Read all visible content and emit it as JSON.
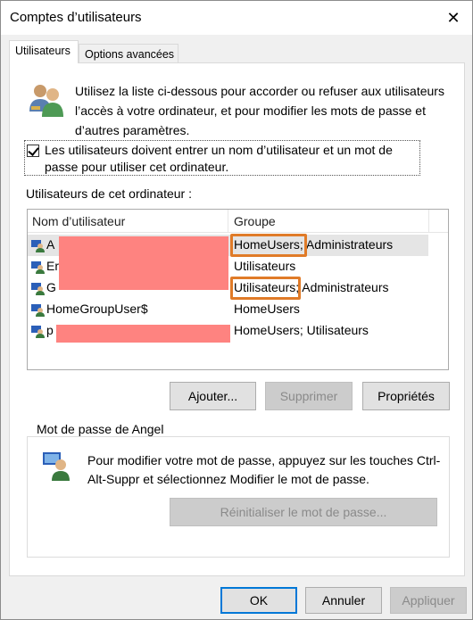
{
  "window": {
    "title": "Comptes d’utilisateurs",
    "close_glyph": "✕"
  },
  "tabs": [
    {
      "label": "Utilisateurs",
      "active": true
    },
    {
      "label": "Options avancées",
      "active": false
    }
  ],
  "intro": {
    "text": "Utilisez la liste ci-dessous pour accorder ou refuser aux utilisateurs l’accès à votre ordinateur, et pour modifier les mots de passe et d’autres paramètres."
  },
  "require_login": {
    "checked": true,
    "label": "Les utilisateurs doivent entrer un nom d’utilisateur et un mot de passe pour utiliser cet ordinateur."
  },
  "users_section": {
    "label": "Utilisateurs de cet ordinateur :"
  },
  "user_list": {
    "columns": [
      "Nom d’utilisateur",
      "Groupe"
    ],
    "rows": [
      {
        "name": "A",
        "group": "HomeUsers; Administrateurs",
        "selected": true
      },
      {
        "name": "Er",
        "group": "Utilisateurs",
        "selected": false
      },
      {
        "name": "G",
        "group": "Utilisateurs; Administrateurs",
        "selected": false
      },
      {
        "name": "HomeGroupUser$",
        "group": "HomeUsers",
        "selected": false
      },
      {
        "name": "p",
        "group": "HomeUsers; Utilisateurs",
        "selected": false
      }
    ]
  },
  "list_buttons": {
    "add": "Ajouter...",
    "remove": "Supprimer",
    "properties": "Propriétés"
  },
  "password_box": {
    "title": "Mot de passe de Angel",
    "text": "Pour modifier votre mot de passe, appuyez sur les touches Ctrl-Alt-Suppr et sélectionnez Modifier le mot de passe.",
    "reset_button": "Réinitialiser le mot de passe..."
  },
  "dialog_buttons": {
    "ok": "OK",
    "cancel": "Annuler",
    "apply": "Appliquer"
  },
  "icons": {
    "users": "users-icon",
    "user": "user-icon",
    "password": "user-key-icon",
    "close": "close-icon"
  },
  "colors": {
    "redaction": "#fe8380",
    "highlight": "#e07b28",
    "focus": "#0078d7"
  }
}
